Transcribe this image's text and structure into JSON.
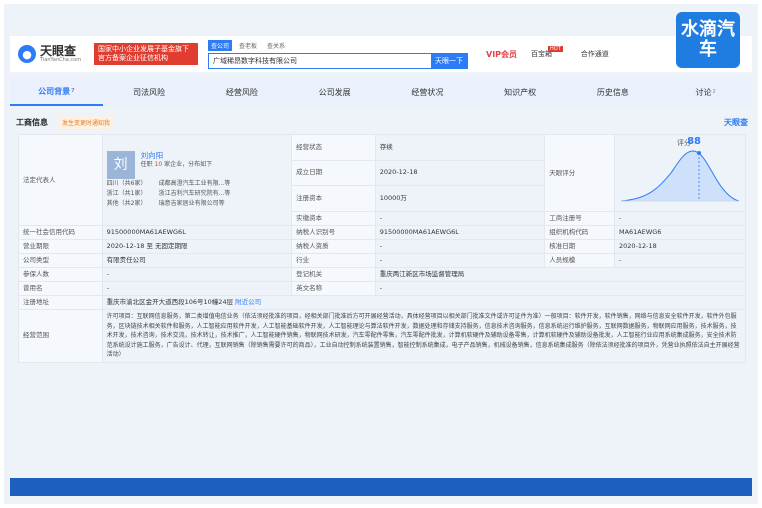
{
  "header": {
    "logo_text": "天眼查",
    "logo_sub": "TianYanCha.com",
    "promo_line1": "国家中小企业发展子基金旗下",
    "promo_line2": "官方备案企业征信机构",
    "search_tabs": [
      "查公司",
      "查老板",
      "查关系"
    ],
    "search_value": "广域稀昂数字科技有限公司",
    "search_button": "天眼一下",
    "nav": [
      "VIP会员",
      "百宝箱",
      "合作通道"
    ],
    "hot": "HOT"
  },
  "watermark": "水滴汽车",
  "tabs": [
    {
      "label": "公司背景",
      "count": "7"
    },
    {
      "label": "司法风险",
      "count": ""
    },
    {
      "label": "经营风险",
      "count": ""
    },
    {
      "label": "公司发展",
      "count": ""
    },
    {
      "label": "经营状况",
      "count": ""
    },
    {
      "label": "知识产权",
      "count": ""
    },
    {
      "label": "历史信息",
      "count": ""
    },
    {
      "label": "讨论",
      "count": "2"
    }
  ],
  "section": {
    "title": "工商信息",
    "news_button": "发生变更时通知我",
    "brand": "天眼查"
  },
  "legal": {
    "key": "法定代表人",
    "avatar": "刘",
    "name": "刘向阳",
    "summary_pre": "任职",
    "summary_num": "10",
    "summary_post": "家企业，分布如下",
    "companies": [
      {
        "province": "四川（共6家）",
        "company": "成都高澄汽车工业有限...等"
      },
      {
        "province": "浙江（共1家）",
        "company": "浙江吉利汽车研究院有...等"
      },
      {
        "province": "其他（共2家）",
        "company": "瑞意吉家居业有限公司等"
      }
    ]
  },
  "rows": {
    "status_k": "经营状态",
    "status_v": "存续",
    "founded_k": "成立日期",
    "founded_v": "2020-12-18",
    "capital_k": "注册资本",
    "capital_v": "10000万",
    "paid_k": "实缴资本",
    "paid_v": "-",
    "score_k": "天眼评分",
    "score_label": "评分",
    "score_val": "88",
    "reg_k": "工商注册号",
    "reg_v": "-",
    "credit_k": "统一社会信用代码",
    "credit_v": "91500000MA61AEWG6L",
    "taxid_k": "纳税人识别号",
    "taxid_v": "91500000MA61AEWG6L",
    "org_k": "组织机构代码",
    "org_v": "MA61AEWG6",
    "term_k": "营业期限",
    "term_v": "2020-12-18 至 无固定期限",
    "taxq_k": "纳税人资质",
    "taxq_v": "-",
    "approve_k": "核准日期",
    "approve_v": "2020-12-18",
    "type_k": "公司类型",
    "type_v": "有限责任公司",
    "industry_k": "行业",
    "industry_v": "-",
    "scale_k": "人员规模",
    "scale_v": "-",
    "insured_k": "参保人数",
    "insured_v": "-",
    "authority_k": "登记机关",
    "authority_v": "重庆两江新区市场监督管理局",
    "former_k": "曾用名",
    "former_v": "-",
    "en_k": "英文名称",
    "en_v": "-",
    "addr_k": "注册地址",
    "addr_v": "重庆市渝北区金开大道西段106号10幢24层",
    "addr_link": "附近公司",
    "scope_k": "经营范围",
    "scope_v": "许可项目：互联网信息服务，第二类增值电信业务（依法须经批准的项目，经相关部门批准后方可开展经营活动，具体经营项目以相关部门批准文件或许可证件为准）一般项目：软件开发，软件销售，网络与信息安全软件开发，软件外包服务，区块链技术相关软件和服务，人工智能应用软件开发，人工智能基础软件开发，人工智能理论与算法软件开发，数据处理和存储支持服务，信息技术咨询服务，信息系统运行维护服务，互联网数据服务，物联网应用服务，技术服务，技术开发，技术咨询，技术交流，技术转让，技术推广，人工智能硬件销售，物联网技术研发，汽车零配件零售，汽车零配件批发，计算机软硬件及辅助设备零售，计算机软硬件及辅助设备批发，人工智能行业应用系统集成服务，安全技术防范系统设计施工服务，广告设计、代理，互联网销售（除销售需要许可的商品），工业自动控制系统装置销售，智能控制系统集成，电子产品销售，机械设备销售，信息系统集成服务（除依法须经批准的项目外，凭营业执照依法自主开展经营活动）"
  }
}
